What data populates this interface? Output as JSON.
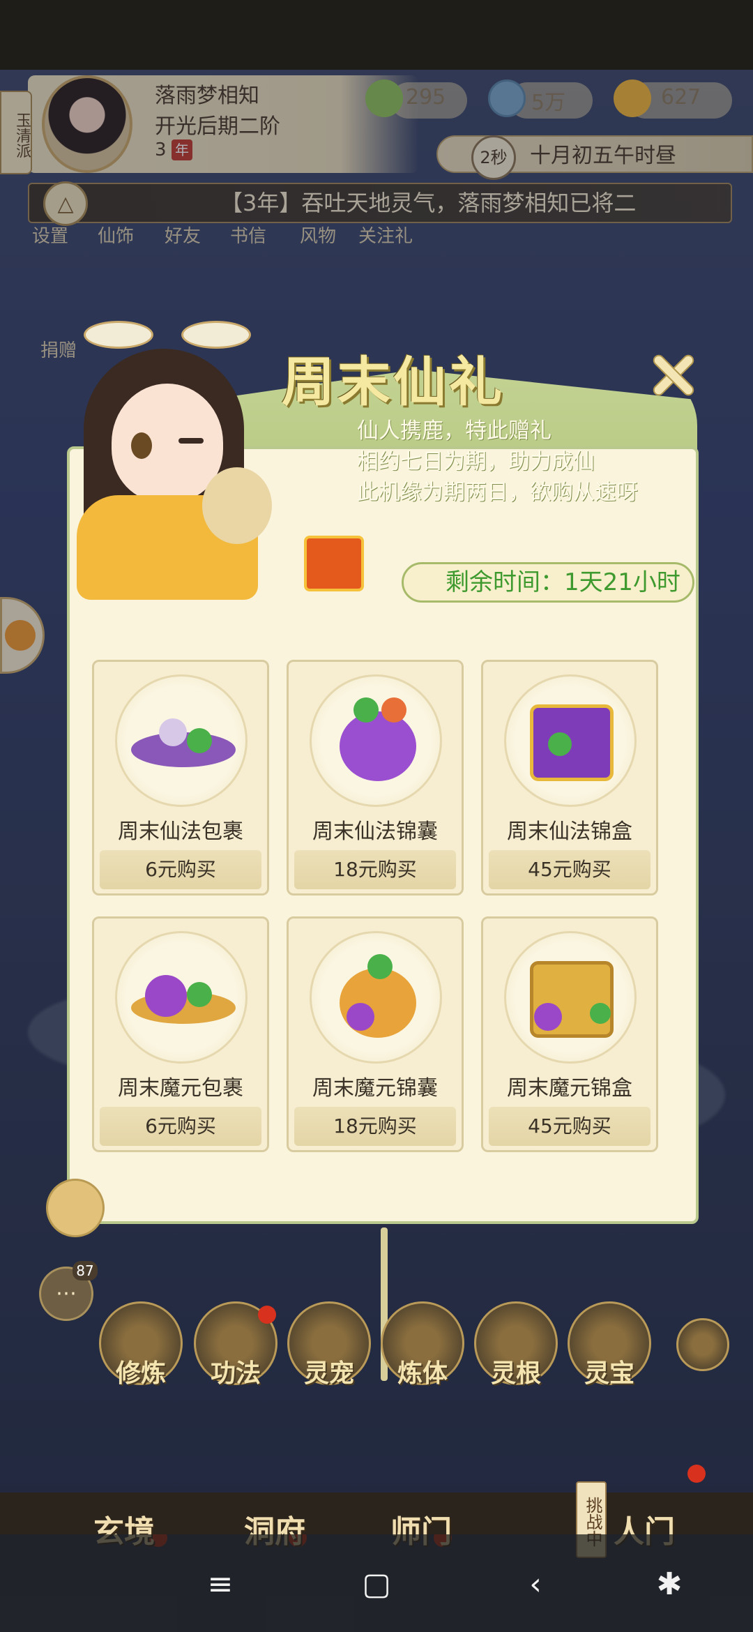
{
  "header": {
    "sect": "玉清派",
    "player_name": "落雨梦相知",
    "realm": "开光后期二阶",
    "age_num": "3",
    "age_unit": "年",
    "resources": [
      {
        "icon": "jade-leaf-icon",
        "value": "295"
      },
      {
        "icon": "coin-icon",
        "value": "5万"
      },
      {
        "icon": "gold-ingot-icon",
        "value": "627"
      }
    ],
    "time_badge": "2秒",
    "time_text": "十月初五午时昼"
  },
  "marquee": {
    "text": "【3年】吞吐天地灵气，落雨梦相知已将二"
  },
  "mini_menu": [
    "设置",
    "仙饰",
    "好友",
    "书信",
    "风物",
    "关注礼"
  ],
  "side_label": "捐赠",
  "modal": {
    "title": "周末仙礼",
    "desc_lines": [
      "仙人携鹿，特此赠礼",
      "相约七日为期，助力成仙",
      "此机缘为期两日，欲购从速呀"
    ],
    "timer_label": "剩余时间：1天21小时",
    "items": [
      {
        "name": "周末仙法包裹",
        "price": "6元购买"
      },
      {
        "name": "周末仙法锦囊",
        "price": "18元购买"
      },
      {
        "name": "周末仙法锦盒",
        "price": "45元购买"
      },
      {
        "name": "周末魔元包裹",
        "price": "6元购买"
      },
      {
        "name": "周末魔元锦囊",
        "price": "18元购买"
      },
      {
        "name": "周末魔元锦盒",
        "price": "45元购买"
      }
    ]
  },
  "chat_badge": "87",
  "skills": [
    "修炼",
    "功法",
    "灵宠",
    "炼体",
    "灵根",
    "灵宝"
  ],
  "dock": {
    "labels": [
      "玄境",
      "洞府",
      "师门",
      "人门"
    ],
    "challenge": "挑战中"
  },
  "colors": {
    "timer_text": "#3e9a2e",
    "title": "#f5e8a0",
    "red_dot": "#d8311e"
  }
}
